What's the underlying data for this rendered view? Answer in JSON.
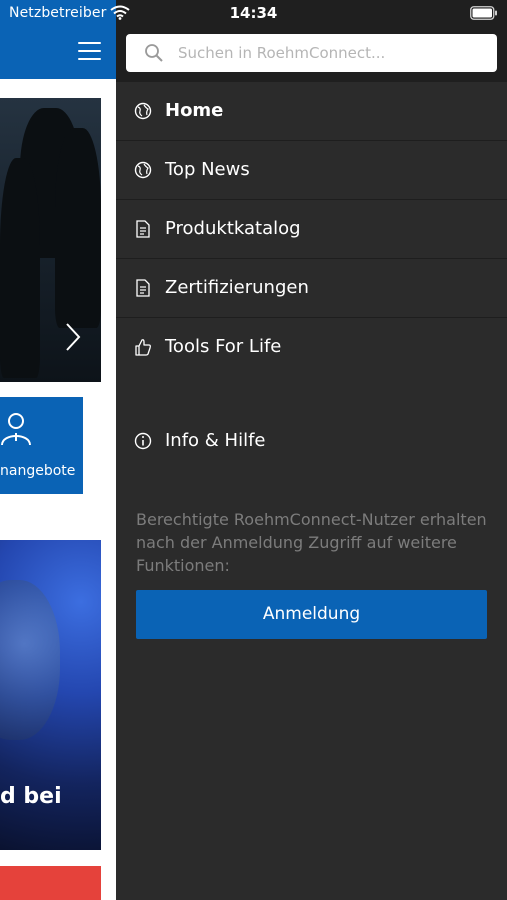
{
  "status_bar": {
    "carrier": "Netzbetreiber",
    "time": "14:34",
    "icons": [
      "wifi-icon",
      "battery-icon"
    ]
  },
  "background_app": {
    "header_color": "#0a63b5",
    "tile_label": "nangebote",
    "photo_caption": "d bei"
  },
  "drawer": {
    "search": {
      "placeholder": "Suchen in RoehmConnect..."
    },
    "menu_items": [
      {
        "label": "Home",
        "icon": "globe-icon",
        "active": true
      },
      {
        "label": "Top News",
        "icon": "globe-icon",
        "active": false
      },
      {
        "label": "Produktkatalog",
        "icon": "document-icon",
        "active": false
      },
      {
        "label": "Zertifizierungen",
        "icon": "document-icon",
        "active": false
      },
      {
        "label": "Tools For Life",
        "icon": "thumbs-up-icon",
        "active": false
      }
    ],
    "info_item": {
      "label": "Info & Hilfe",
      "icon": "info-icon"
    },
    "login_note": "Berechtigte RoehmConnect-Nutzer erhalten nach der Anmeldung Zugriff auf weitere Funktionen:",
    "login_button": "Anmeldung"
  },
  "colors": {
    "accent": "#0a63b5",
    "drawer_bg": "#2b2b2b",
    "drawer_top_bg": "#1f1f1f",
    "muted_text": "#7c7c7c"
  }
}
